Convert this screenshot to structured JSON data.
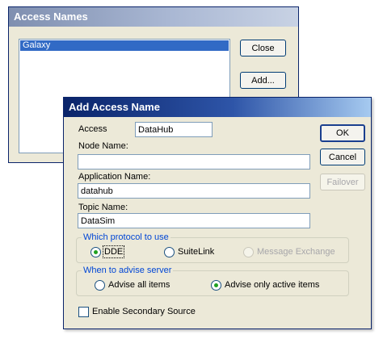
{
  "access_names": {
    "title": "Access Names",
    "list_items": [
      "Galaxy"
    ],
    "close_label": "Close",
    "add_label": "Add..."
  },
  "add_access_name": {
    "title": "Add Access Name",
    "access_label": "Access",
    "access_value": "DataHub",
    "node_label": "Node Name:",
    "node_value": "",
    "app_label": "Application Name:",
    "app_value": "datahub",
    "topic_label": "Topic Name:",
    "topic_value": "DataSim",
    "ok_label": "OK",
    "cancel_label": "Cancel",
    "failover_label": "Failover",
    "protocol": {
      "legend": "Which protocol to use",
      "options": [
        "DDE",
        "SuiteLink",
        "Message Exchange"
      ],
      "selected": "DDE"
    },
    "advise": {
      "legend": "When to advise server",
      "options": [
        "Advise all items",
        "Advise only active items"
      ],
      "selected": "Advise only active items"
    },
    "secondary_label": "Enable Secondary Source",
    "secondary_checked": false
  }
}
